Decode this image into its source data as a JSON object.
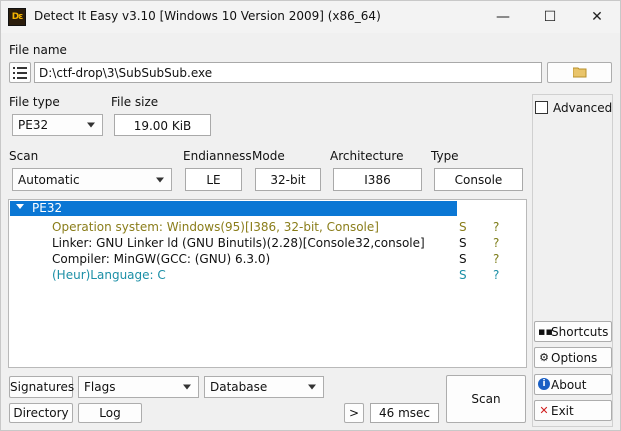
{
  "titlebar": {
    "app_icon_text": "Dε",
    "title": "Detect It Easy v3.10 [Windows 10 Version 2009] (x86_64)",
    "minimize": "—",
    "maximize": "☐",
    "close": "✕"
  },
  "file_name": {
    "label": "File name",
    "value": "D:\\ctf-drop\\3\\SubSubSub.exe"
  },
  "file_type": {
    "label": "File type",
    "value": "PE32"
  },
  "file_size": {
    "label": "File size",
    "value": "19.00 KiB"
  },
  "scan": {
    "label": "Scan",
    "value": "Automatic"
  },
  "endianness": {
    "label": "Endianness",
    "value": "LE"
  },
  "mode": {
    "label": "Mode",
    "value": "32-bit"
  },
  "architecture": {
    "label": "Architecture",
    "value": "I386"
  },
  "type": {
    "label": "Type",
    "value": "Console"
  },
  "advanced": {
    "label": "Advanced",
    "checked": false
  },
  "results": {
    "root": "PE32",
    "rows": [
      {
        "text": "Operation system: Windows(95)[I386, 32-bit, Console]",
        "s": "S",
        "q": "?",
        "color": "#8a7d1a"
      },
      {
        "text": "Linker: GNU Linker ld (GNU Binutils)(2.28)[Console32,console]",
        "s": "S",
        "q": "?",
        "color": "#111111"
      },
      {
        "text": "Compiler: MinGW(GCC: (GNU) 6.3.0)",
        "s": "S",
        "q": "?",
        "color": "#111111"
      },
      {
        "text": "(Heur)Language: C",
        "s": "S",
        "q": "?",
        "color": "#1b8fa6"
      }
    ],
    "q_color": "#7d7d1a",
    "s_color_heur": "#1b8fa6",
    "q_color_heur": "#1b8fa6"
  },
  "side_buttons": {
    "shortcuts": "Shortcuts",
    "options": "Options",
    "about": "About",
    "exit": "Exit"
  },
  "bottom": {
    "signatures": "Signatures",
    "flags": "Flags",
    "database": "Database",
    "directory": "Directory",
    "log": "Log",
    "next": ">",
    "time": "46 msec",
    "scan": "Scan"
  },
  "colors": {
    "accent": "#0b77d4",
    "exit_icon": "#d01c1c",
    "about_icon": "#1a5fc4"
  }
}
